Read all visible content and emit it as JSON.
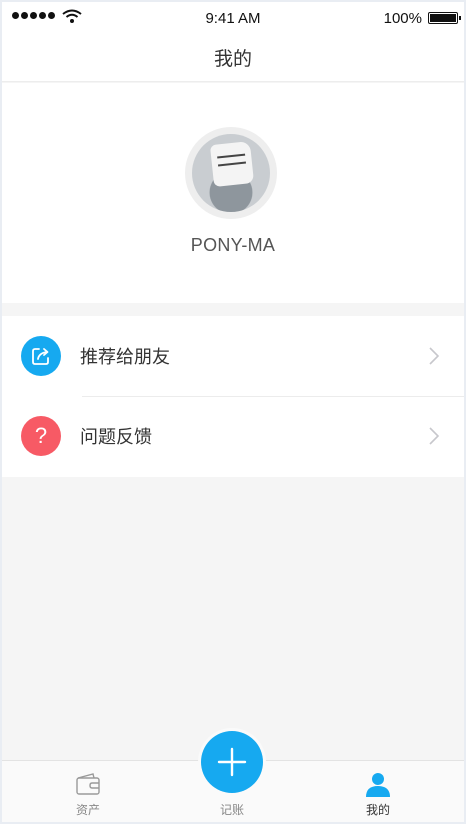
{
  "status_bar": {
    "time": "9:41 AM",
    "battery": "100%"
  },
  "nav": {
    "title": "我的"
  },
  "profile": {
    "name": "PONY-MA"
  },
  "menu": {
    "items": [
      {
        "label": "推荐给朋友",
        "icon": "share-icon",
        "color": "#16a9f0"
      },
      {
        "label": "问题反馈",
        "icon": "question-icon",
        "icon_text": "?",
        "color": "#f75a65"
      }
    ]
  },
  "tabs": [
    {
      "label": "资产",
      "icon": "wallet-icon"
    },
    {
      "label": "记账",
      "icon": "plus-icon",
      "color": "#16a9f0"
    },
    {
      "label": "我的",
      "icon": "user-icon",
      "active": true,
      "color": "#16a9f0"
    }
  ]
}
